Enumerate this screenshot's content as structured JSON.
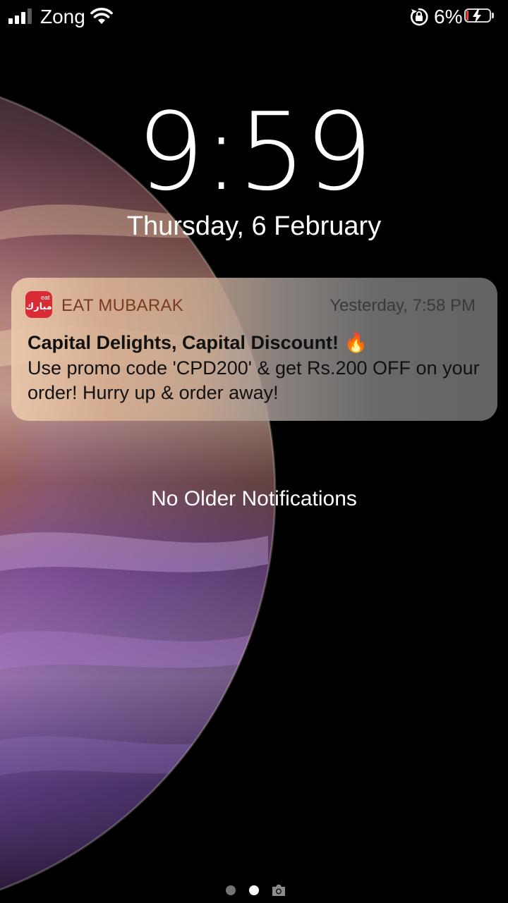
{
  "status_bar": {
    "carrier": "Zong",
    "battery_percent": "6%",
    "icons": [
      "signal-icon",
      "wifi-icon",
      "rotation-lock-icon",
      "battery-charging-icon"
    ]
  },
  "lock_screen": {
    "time": "9:59",
    "date": "Thursday, 6 February",
    "no_older_text": "No Older Notifications"
  },
  "notification": {
    "app_name": "EAT MUBARAK",
    "app_icon": {
      "small_text": "eat",
      "main_text": "مبارك",
      "color": "#d92b36"
    },
    "time": "Yesterday, 7:58 PM",
    "title": "Capital Delights, Capital Discount!",
    "title_emoji": "🔥",
    "body": "Use promo code 'CPD200' & get Rs.200 OFF on your order! Hurry up & order away!"
  },
  "page_indicator": {
    "current_page": 2,
    "pages": 2,
    "camera_icon": "camera-icon"
  }
}
